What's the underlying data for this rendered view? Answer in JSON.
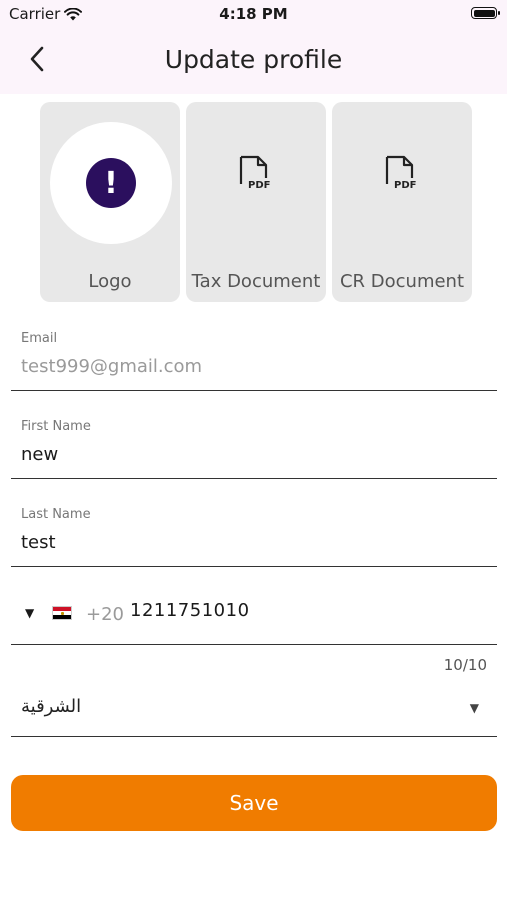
{
  "status_bar": {
    "carrier": "Carrier",
    "time": "4:18 PM"
  },
  "header": {
    "title": "Update profile",
    "back_icon": "chevron-left-icon"
  },
  "documents": [
    {
      "label": "Logo",
      "icon": "alert-icon"
    },
    {
      "label": "Tax Document",
      "icon": "pdf-file-icon"
    },
    {
      "label": "CR Document",
      "icon": "pdf-file-icon"
    }
  ],
  "pdf_badge": "PDF",
  "alert_glyph": "!",
  "form": {
    "email": {
      "label": "Email",
      "value": "test999@gmail.com"
    },
    "first_name": {
      "label": "First Name",
      "value": "new"
    },
    "last_name": {
      "label": "Last Name",
      "value": "test"
    },
    "phone": {
      "country_flag": "egypt-flag-icon",
      "dial_code": "+20",
      "number": "1211751010",
      "counter": "10/10"
    },
    "region": {
      "value": "الشرقية"
    }
  },
  "save_label": "Save",
  "colors": {
    "accent": "#f07c00",
    "alert": "#2b0f5e",
    "header_bg": "#fcf4fb"
  }
}
